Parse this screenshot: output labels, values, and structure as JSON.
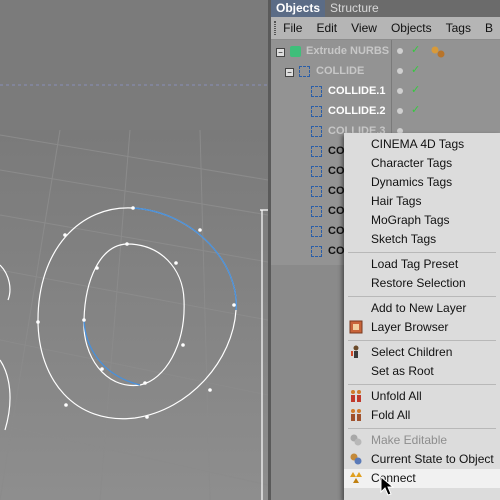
{
  "tabs": [
    {
      "label": "Objects",
      "active": true
    },
    {
      "label": "Structure",
      "active": false
    }
  ],
  "menubar": [
    "File",
    "Edit",
    "View",
    "Objects",
    "Tags",
    "B"
  ],
  "tree": [
    {
      "label": "Extrude NURBS",
      "style": "dim"
    },
    {
      "label": "COLLIDE",
      "style": "dim"
    },
    {
      "label": "COLLIDE.1",
      "style": "white"
    },
    {
      "label": "COLLIDE.2",
      "style": "white"
    },
    {
      "label": "COLLIDE.3",
      "style": "dim"
    },
    {
      "label": "CO",
      "style": "normal"
    },
    {
      "label": "CO",
      "style": "normal"
    },
    {
      "label": "CO",
      "style": "normal"
    },
    {
      "label": "CO",
      "style": "normal"
    },
    {
      "label": "CO",
      "style": "normal"
    },
    {
      "label": "CO",
      "style": "normal"
    }
  ],
  "context_menu": {
    "items": [
      {
        "label": "CINEMA 4D Tags"
      },
      {
        "label": "Character Tags"
      },
      {
        "label": "Dynamics Tags"
      },
      {
        "label": "Hair Tags"
      },
      {
        "label": "MoGraph Tags"
      },
      {
        "label": "Sketch Tags"
      },
      {
        "label": "Load Tag Preset"
      },
      {
        "label": "Restore Selection"
      },
      {
        "label": "Add to New Layer"
      },
      {
        "label": "Layer Browser",
        "icon": "layer-browser-icon"
      },
      {
        "label": "Select Children",
        "icon": "select-children-icon"
      },
      {
        "label": "Set as Root"
      },
      {
        "label": "Unfold All",
        "icon": "unfold-all-icon"
      },
      {
        "label": "Fold All",
        "icon": "fold-all-icon"
      },
      {
        "label": "Make Editable",
        "icon": "make-editable-icon",
        "disabled": true
      },
      {
        "label": "Current State to Object",
        "icon": "current-state-icon"
      },
      {
        "label": "Connect",
        "icon": "connect-icon",
        "highlighted": true
      }
    ]
  },
  "colors": {
    "accent_tab": "#5b6c86",
    "check": "#36c940",
    "selection_blue": "#4a90d9"
  }
}
